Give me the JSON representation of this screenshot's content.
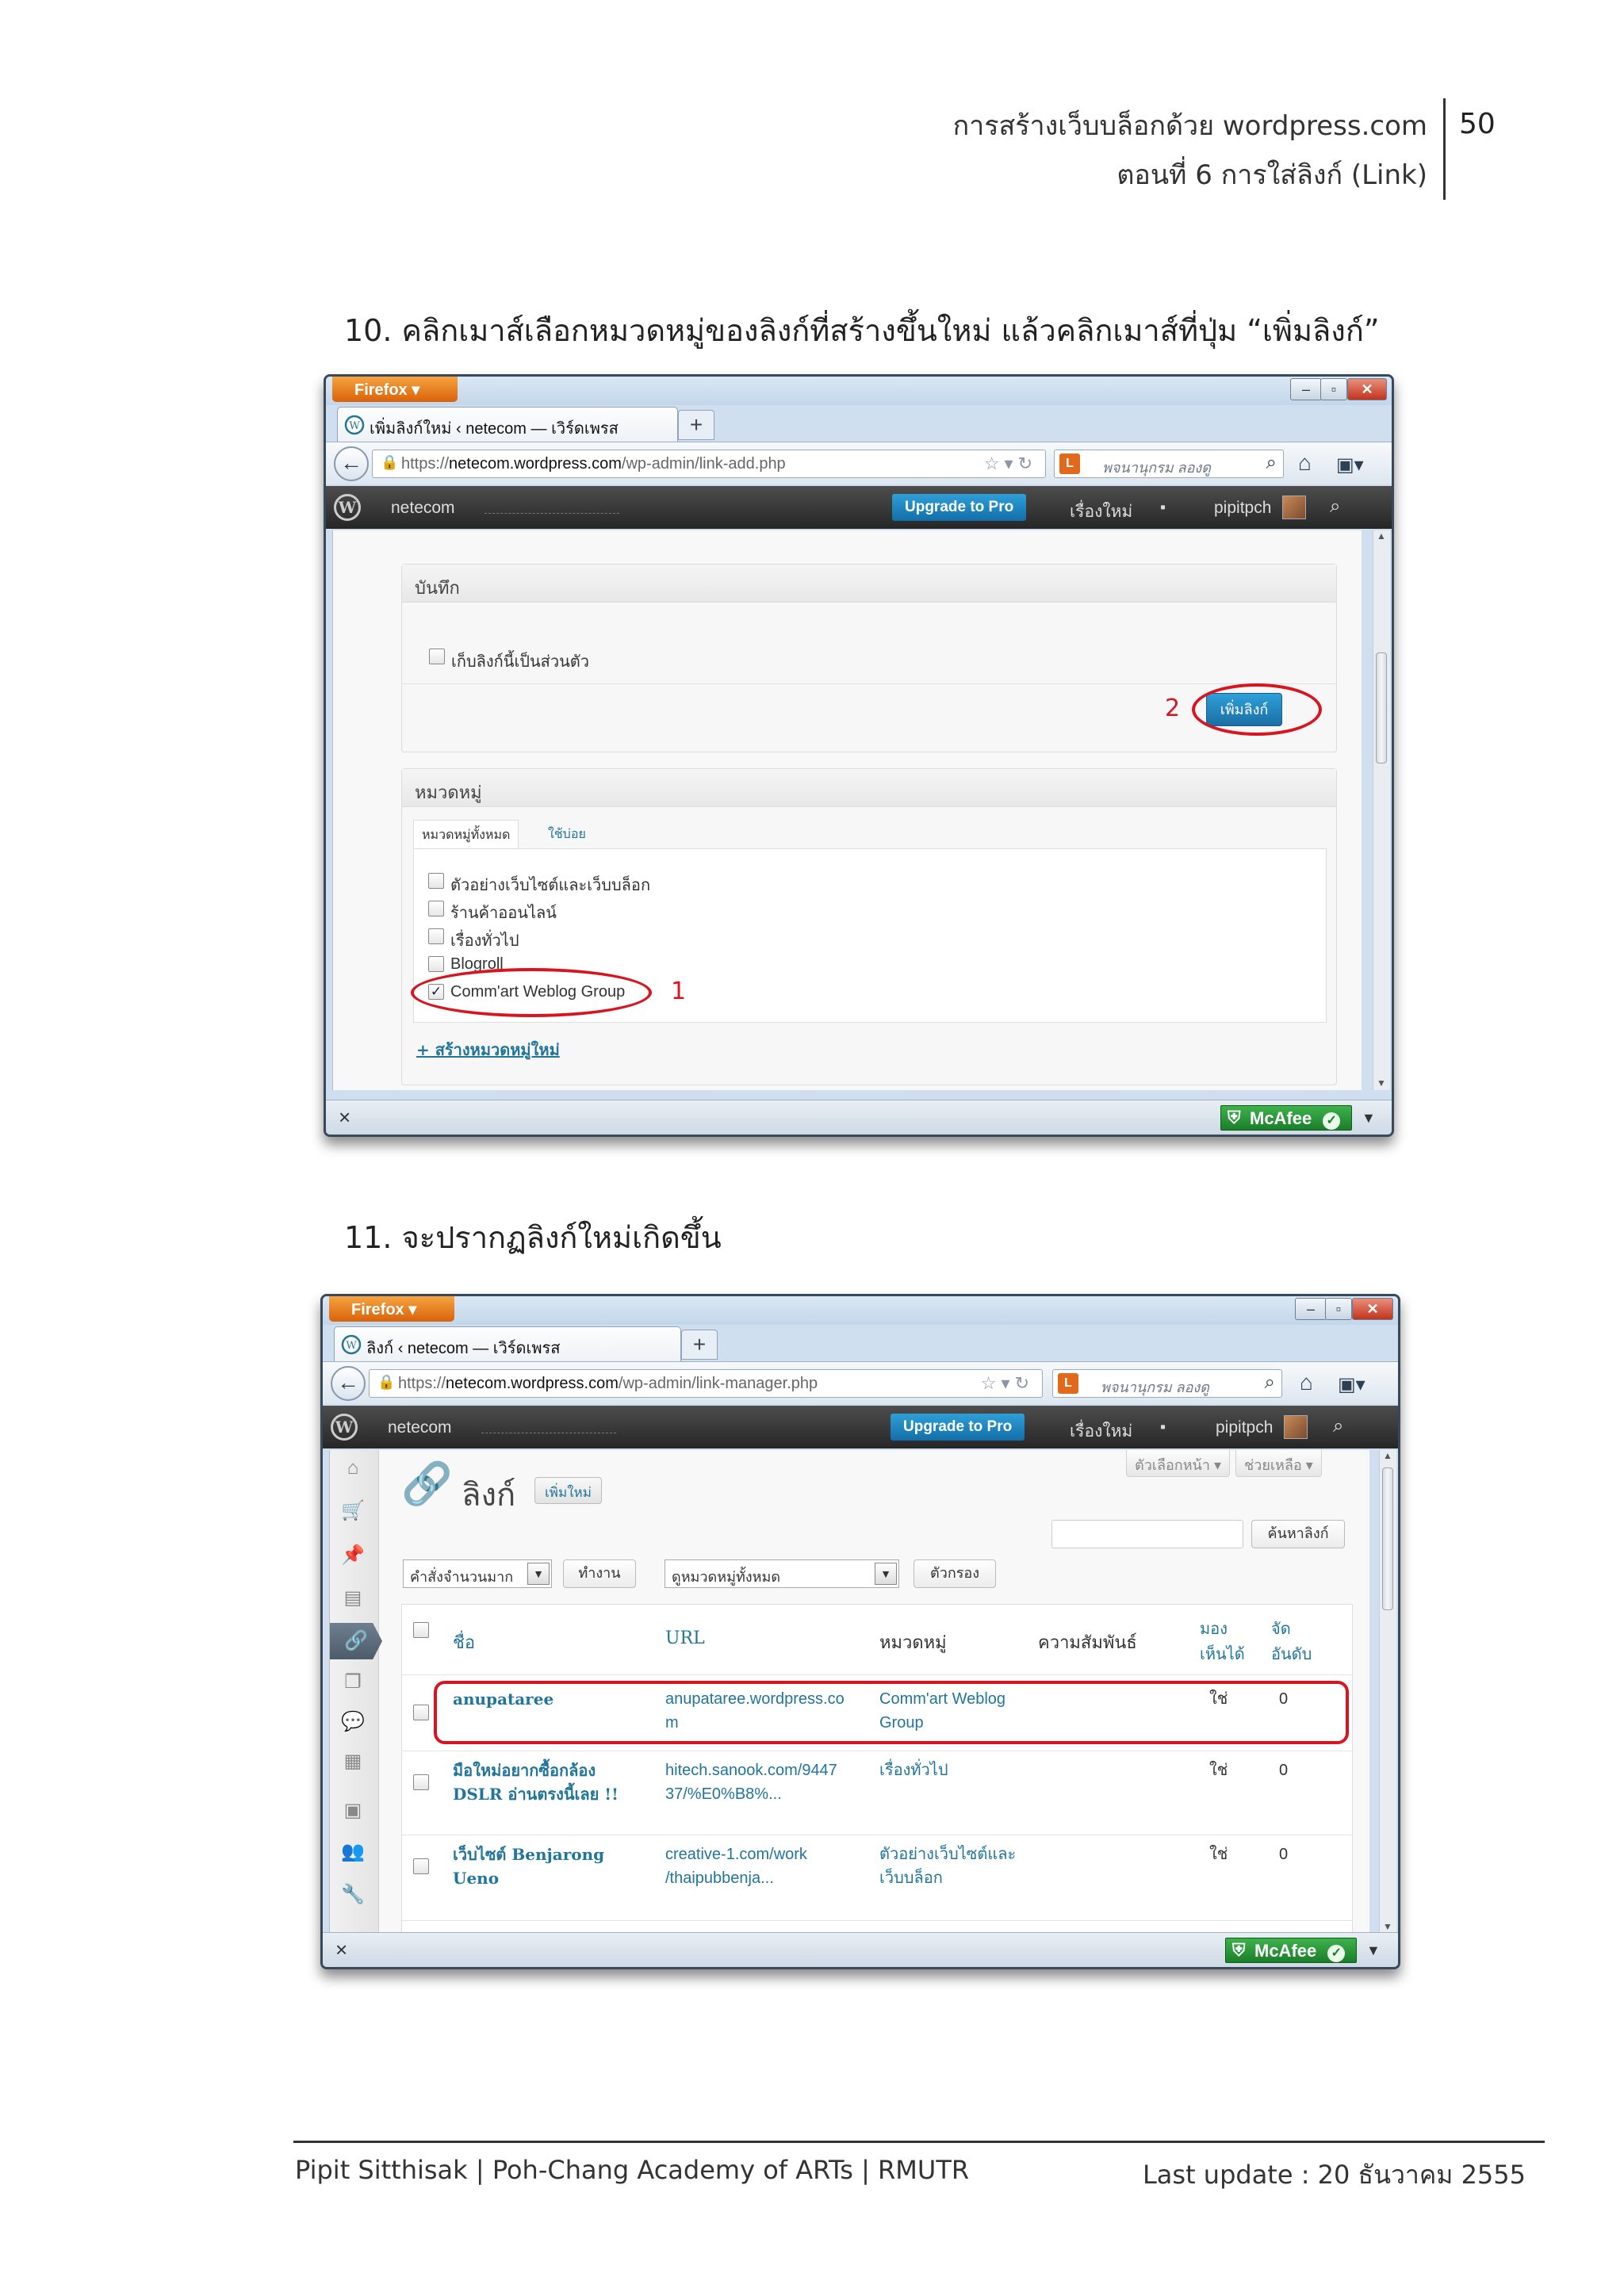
{
  "header": {
    "title_line1": "การสร้างเว็บบล็อกด้วย wordpress.com",
    "title_line2": "ตอนที่ 6 การใส่ลิงก์ (Link)",
    "page_number": "50"
  },
  "steps": {
    "step10": "10. คลิกเมาส์เลือกหมวดหมู่ของลิงก์ที่สร้างขึ้นใหม่  แล้วคลิกเมาส์ที่ปุ่ม “เพิ่มลิงก์”",
    "step11": "11. จะปรากฏลิงก์ใหม่เกิดขึ้น"
  },
  "browser": {
    "firefox_label": "Firefox",
    "search_placeholder": "พจนานุกรม ลองดู",
    "site_name": "netecom",
    "upgrade_label": "Upgrade to Pro",
    "new_post_label": "เรื่องใหม่",
    "username": "pipitpch",
    "mcafee_label": "McAfee"
  },
  "window1": {
    "tab_title": "เพิ่มลิงก์ใหม่ ‹ netecom — เวิร์ดเพรส",
    "url_prefix": "https://",
    "url_domain": "netecom.wordpress.com",
    "url_path": "/wp-admin/link-add.php",
    "save_box_title": "บันทึก",
    "private_label": "เก็บลิงก์นี้เป็นส่วนตัว",
    "add_link_button": "เพิ่มลิงก์",
    "annotation_2": "2",
    "category_box_title": "หมวดหมู่",
    "tab_all": "หมวดหมู่ทั้งหมด",
    "tab_popular": "ใช้บ่อย",
    "categories": [
      {
        "label": "ตัวอย่างเว็บไซต์และเว็บบล็อก",
        "checked": false
      },
      {
        "label": "ร้านค้าออนไลน์",
        "checked": false
      },
      {
        "label": "เรื่องทั่วไป",
        "checked": false
      },
      {
        "label": "Blogroll",
        "checked": false
      },
      {
        "label": "Comm'art Weblog Group",
        "checked": true
      }
    ],
    "annotation_1": "1",
    "add_category_link": "+ สร้างหมวดหมู่ใหม่"
  },
  "window2": {
    "tab_title": "ลิงก์ ‹ netecom — เวิร์ดเพรส",
    "url_prefix": "https://",
    "url_domain": "netecom.wordpress.com",
    "url_path": "/wp-admin/link-manager.php",
    "screen_options": "ตัวเลือกหน้า ▾",
    "help": "ช่วยเหลือ ▾",
    "page_title": "ลิงก์",
    "add_new": "เพิ่มใหม่",
    "search_button": "ค้นหาลิงก์",
    "bulk_actions": "คำสั่งจำนวนมาก",
    "apply_button": "ทำงาน",
    "category_filter": "ดูหมวดหมู่ทั้งหมด",
    "filter_button": "ตัวกรอง",
    "columns": {
      "name": "ชื่อ",
      "url": "URL",
      "category": "หมวดหมู่",
      "relationship": "ความสัมพันธ์",
      "visible_line1": "มอง",
      "visible_line2": "เห็นได้",
      "rating_line1": "จัด",
      "rating_line2": "อันดับ"
    },
    "rows": [
      {
        "name_line1": "anupataree",
        "name_line2": "",
        "url_line1": "anupataree.wordpress.co",
        "url_line2": "m",
        "category_line1": "Comm'art Weblog",
        "category_line2": "Group",
        "visible": "ใช่",
        "rating": "0"
      },
      {
        "name_line1": "มือใหม่อยากซื้อกล้อง",
        "name_line2": "DSLR อ่านตรงนี้เลย !!",
        "url_line1": "hitech.sanook.com/9447",
        "url_line2": "37/%E0%B8%...",
        "category_line1": "เรื่องทั่วไป",
        "category_line2": "",
        "visible": "ใช่",
        "rating": "0"
      },
      {
        "name_line1": "เว็บไซต์ Benjarong",
        "name_line2": "Ueno",
        "url_line1": "creative-1.com/work",
        "url_line2": "/thaipubbenja...",
        "category_line1": "ตัวอย่างเว็บไซต์และ",
        "category_line2": "เว็บบล็อก",
        "visible": "ใช่",
        "rating": "0"
      }
    ]
  },
  "footer": {
    "left": "Pipit Sitthisak | Poh-Chang Academy of ARTs | RMUTR",
    "right": "Last update : 20 ธันวาคม  2555"
  },
  "colors": {
    "annotation_red": "#d9141f",
    "wp_link_blue": "#21759b",
    "upgrade_blue": "#1f86c4",
    "mcafee_green": "#2a9a38"
  }
}
